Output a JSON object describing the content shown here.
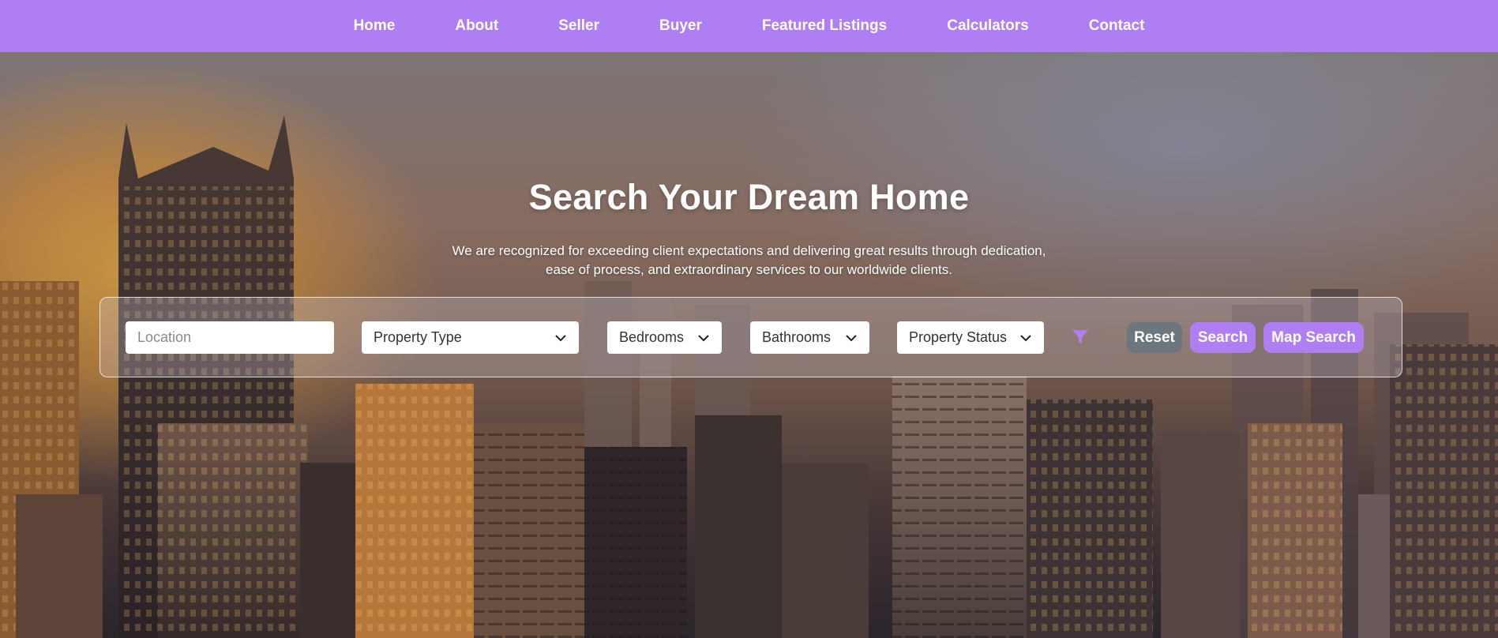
{
  "nav": {
    "items": [
      {
        "label": "Home"
      },
      {
        "label": "About"
      },
      {
        "label": "Seller"
      },
      {
        "label": "Buyer"
      },
      {
        "label": "Featured Listings"
      },
      {
        "label": "Calculators"
      },
      {
        "label": "Contact"
      }
    ]
  },
  "hero": {
    "title": "Search Your Dream Home",
    "subtitle_line1": "We are recognized for exceeding client expectations and delivering great results through dedication,",
    "subtitle_line2": "ease of process, and extraordinary services to our worldwide clients."
  },
  "search": {
    "location_placeholder": "Location",
    "location_value": "",
    "property_type": "Property Type",
    "bedrooms": "Bedrooms",
    "bathrooms": "Bathrooms",
    "property_status": "Property Status",
    "filter_icon": "filter-icon",
    "reset_label": "Reset",
    "search_label": "Search",
    "map_search_label": "Map Search"
  },
  "colors": {
    "accent": "#b07ef3",
    "reset_button": "#6d757d",
    "text_on_accent": "#ffffff"
  }
}
